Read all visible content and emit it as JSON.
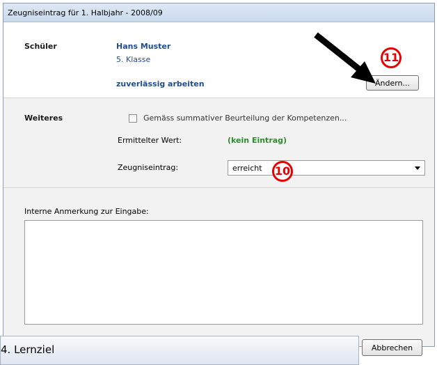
{
  "window": {
    "title": "Zeugniseintrag für 1. Halbjahr - 2008/09"
  },
  "student_section": {
    "label": "Schüler",
    "name": "Hans Muster",
    "class": "5. Klasse",
    "criterion": "zuverlässig arbeiten",
    "change_button": {
      "label": "Ändern..."
    }
  },
  "more_section": {
    "label": "Weiteres",
    "checkbox": {
      "label": "Gemäss summativer Beurteilung der Kompetenzen...",
      "checked": false
    },
    "determined_label": "Ermittelter Wert:",
    "determined_value": "(kein Eintrag)",
    "report_entry_label": "Zeugniseintrag:",
    "report_entry_value": "erreicht"
  },
  "notes_section": {
    "label": "Interne Anmerkung zur Eingabe:",
    "value": ""
  },
  "footer": {
    "cancel_button": {
      "label": "Abbrechen"
    }
  },
  "background_window": {
    "title": "4. Lernziel"
  },
  "annotations": {
    "arrow": {
      "color": "#000000"
    },
    "markers": [
      {
        "number": "11",
        "color": "#e60000"
      },
      {
        "number": "10",
        "color": "#e60000"
      }
    ]
  }
}
